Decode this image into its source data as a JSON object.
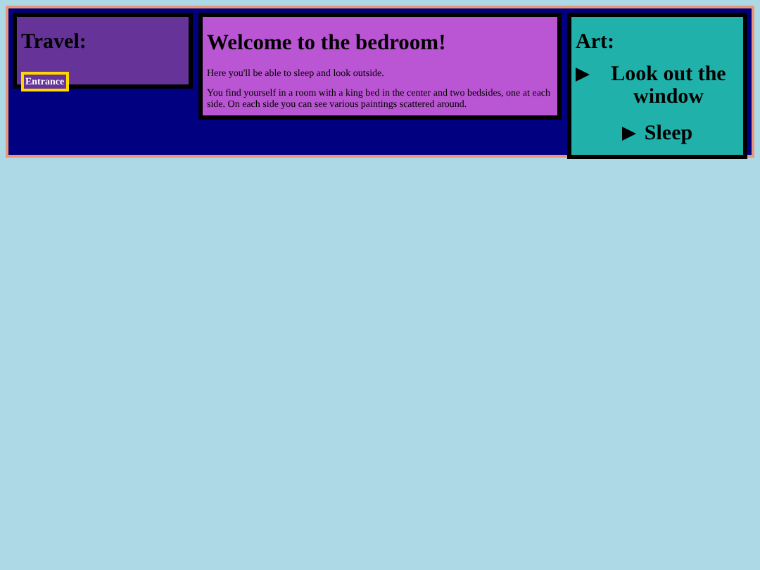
{
  "travel": {
    "title": "Travel:",
    "buttons": [
      "Entrance"
    ]
  },
  "main": {
    "title": "Welcome to the bedroom!",
    "paragraphs": [
      "Here you'll be able to sleep and look outside.",
      "You find yourself in a room with a king bed in the center and two bedsides, one at each side. On each side you can see various paintings scattered around."
    ]
  },
  "art": {
    "title": "Art:",
    "actions": [
      {
        "label": "Look out the window"
      },
      {
        "label": "Sleep"
      }
    ]
  }
}
